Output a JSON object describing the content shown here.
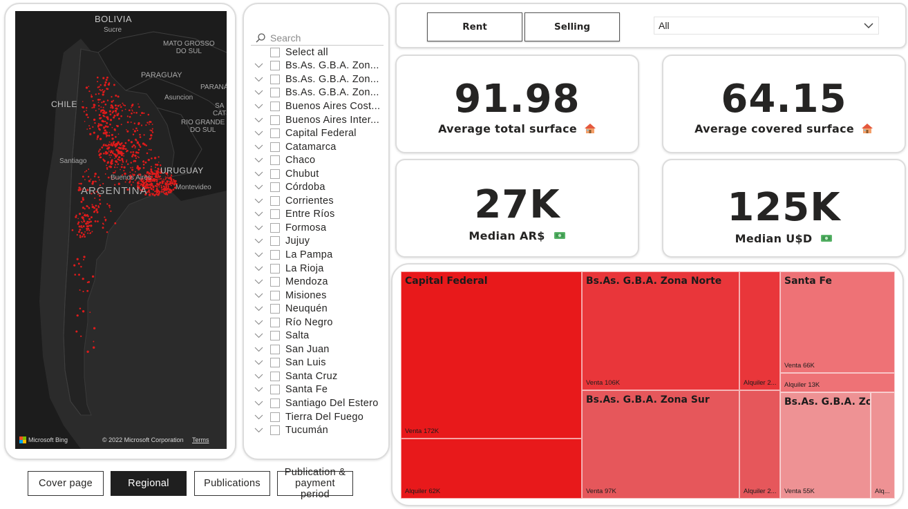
{
  "map": {
    "labels": {
      "bolivia": "BOLIVIA",
      "sucre": "Sucre",
      "mato_grosso": "MATO GROSSO\nDO SUL",
      "paraguay": "PARAGUAY",
      "parana": "PARANÁ",
      "asuncion": "Asuncion",
      "santa": "SA\nCAT",
      "rio_grande": "RIO GRANDE\nDO SUL",
      "chile": "CHILE",
      "santiago": "Santiago",
      "buenos_aires": "Buenos Aires",
      "uruguay": "URUGUAY",
      "argentina": "ARGENTINA",
      "montevideo": "Montevideo"
    },
    "bing": "Microsoft Bing",
    "copyright": "© 2022 Microsoft Corporation",
    "terms": "Terms",
    "colors": {
      "background": "#2b2b2b",
      "land": "#141414",
      "points": "#e01b1b"
    }
  },
  "slicer": {
    "search_placeholder": "Search",
    "select_all": "Select all",
    "items": [
      {
        "label": "Bs.As. G.B.A. Zon...",
        "expandable": true
      },
      {
        "label": "Bs.As. G.B.A. Zon...",
        "expandable": true
      },
      {
        "label": "Bs.As. G.B.A. Zon...",
        "expandable": true
      },
      {
        "label": "Buenos Aires Cost...",
        "expandable": true
      },
      {
        "label": "Buenos Aires Inter...",
        "expandable": true
      },
      {
        "label": "Capital Federal",
        "expandable": true
      },
      {
        "label": "Catamarca",
        "expandable": true
      },
      {
        "label": "Chaco",
        "expandable": true
      },
      {
        "label": "Chubut",
        "expandable": true
      },
      {
        "label": "Córdoba",
        "expandable": true
      },
      {
        "label": "Corrientes",
        "expandable": true
      },
      {
        "label": "Entre Ríos",
        "expandable": true
      },
      {
        "label": "Formosa",
        "expandable": true
      },
      {
        "label": "Jujuy",
        "expandable": true
      },
      {
        "label": "La Pampa",
        "expandable": true
      },
      {
        "label": "La Rioja",
        "expandable": true
      },
      {
        "label": "Mendoza",
        "expandable": true
      },
      {
        "label": "Misiones",
        "expandable": true
      },
      {
        "label": "Neuquén",
        "expandable": true
      },
      {
        "label": "Río Negro",
        "expandable": true
      },
      {
        "label": "Salta",
        "expandable": true
      },
      {
        "label": "San Juan",
        "expandable": true
      },
      {
        "label": "San Luis",
        "expandable": true
      },
      {
        "label": "Santa Cruz",
        "expandable": true
      },
      {
        "label": "Santa Fe",
        "expandable": true
      },
      {
        "label": "Santiago Del Estero",
        "expandable": true
      },
      {
        "label": "Tierra Del Fuego",
        "expandable": true
      },
      {
        "label": "Tucumán",
        "expandable": true
      }
    ]
  },
  "nav": {
    "cover": "Cover page",
    "regional": "Regional",
    "publications": "Publications",
    "pub_payment": "Publication & payment period"
  },
  "toggle": {
    "rent": "Rent",
    "selling": "Selling",
    "dropdown_value": "All"
  },
  "kpis": {
    "total_surface": {
      "value": "91.98",
      "label": "Average total surface",
      "icon": "house-icon"
    },
    "covered_surface": {
      "value": "64.15",
      "label": "Average covered surface",
      "icon": "house-icon"
    },
    "median_ars": {
      "value": "27K",
      "label": "Median AR$",
      "icon": "money-icon"
    },
    "median_usd": {
      "value": "125K",
      "label": "Median U$D",
      "icon": "money-icon"
    }
  },
  "treemap": {
    "groups": [
      {
        "title": "Capital Federal",
        "color": "#e8191b",
        "cells": [
          {
            "label": "Venta 172K"
          },
          {
            "label": "Alquiler 62K"
          }
        ]
      },
      {
        "title": "Bs.As. G.B.A. Zona Norte",
        "color": "#e9363a",
        "cells": [
          {
            "label": "Venta 106K"
          },
          {
            "label": "Alquiler 2..."
          }
        ]
      },
      {
        "title": "Bs.As. G.B.A. Zona Sur",
        "color": "#e6575b",
        "cells": [
          {
            "label": "Venta 97K"
          },
          {
            "label": "Alquiler 2..."
          }
        ]
      },
      {
        "title": "Santa Fe",
        "color": "#ee7276",
        "cells": [
          {
            "label": "Venta 66K"
          },
          {
            "label": "Alquiler 13K"
          }
        ]
      },
      {
        "title": "Bs.As. G.B.A. Zon...",
        "color": "#ee9294",
        "cells": [
          {
            "label": "Venta 55K"
          },
          {
            "label": "Alq..."
          }
        ]
      }
    ]
  }
}
